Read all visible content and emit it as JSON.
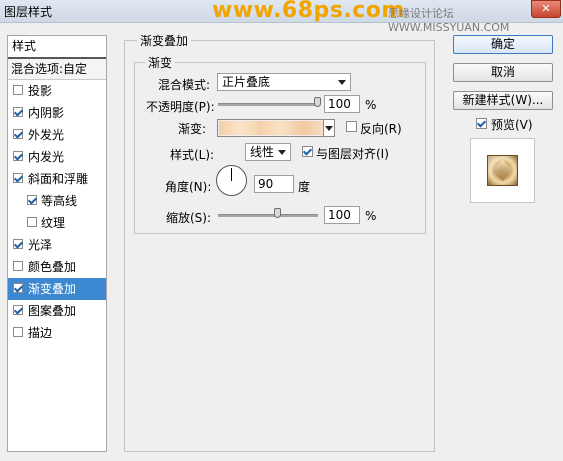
{
  "window": {
    "title": "图层样式",
    "watermark": "www.68ps.com",
    "watermark2": "思缘设计论坛  WWW.MISSYUAN.COM",
    "close_label": "✕"
  },
  "styles_panel": {
    "header": "样式",
    "blend_options": "混合选项:自定",
    "items": [
      {
        "label": "投影",
        "checked": false
      },
      {
        "label": "内阴影",
        "checked": true
      },
      {
        "label": "外发光",
        "checked": true
      },
      {
        "label": "内发光",
        "checked": true
      },
      {
        "label": "斜面和浮雕",
        "checked": true
      },
      {
        "label": "等高线",
        "checked": true,
        "sub": true
      },
      {
        "label": "纹理",
        "checked": false,
        "sub": true
      },
      {
        "label": "光泽",
        "checked": true
      },
      {
        "label": "颜色叠加",
        "checked": false
      },
      {
        "label": "渐变叠加",
        "checked": true,
        "selected": true
      },
      {
        "label": "图案叠加",
        "checked": true
      },
      {
        "label": "描边",
        "checked": false
      }
    ]
  },
  "gradient_overlay": {
    "section_title": "渐变叠加",
    "group_title": "渐变",
    "blend_mode_label": "混合模式:",
    "blend_mode_value": "正片叠底",
    "opacity_label": "不透明度(P):",
    "opacity_value": "100",
    "opacity_unit": "%",
    "opacity_fraction": 1.0,
    "gradient_label": "渐变:",
    "reverse_label": "反向(R)",
    "reverse_checked": false,
    "style_label": "样式(L):",
    "style_value": "线性",
    "align_label": "与图层对齐(I)",
    "align_checked": true,
    "angle_label": "角度(N):",
    "angle_value": "90",
    "angle_unit": "度",
    "scale_label": "缩放(S):",
    "scale_value": "100",
    "scale_unit": "%",
    "scale_fraction": 0.6
  },
  "buttons": {
    "ok": "确定",
    "cancel": "取消",
    "new_style": "新建样式(W)...",
    "preview_label": "预览(V)",
    "preview_checked": true
  }
}
